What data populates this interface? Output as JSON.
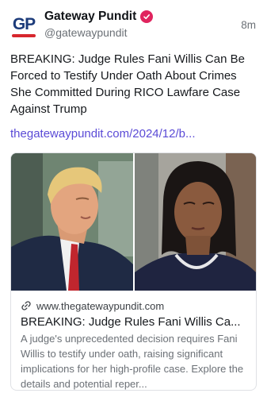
{
  "author": {
    "display_name": "Gateway Pundit",
    "handle": "@gatewaypundit",
    "avatar_text": "GP",
    "verified": true
  },
  "timestamp": "8m",
  "post": {
    "text": "BREAKING: Judge Rules Fani Willis Can Be Forced to Testify Under Oath About Crimes She Committed During RICO Lawfare Case Against Trump",
    "link_text": "thegatewaypundit.com/2024/12/b..."
  },
  "card": {
    "domain": "www.thegatewaypundit.com",
    "title": "BREAKING: Judge Rules Fani Willis Ca...",
    "description": "A judge's unprecedented decision requires Fani Willis to testify under oath, raising significant implications for her high-profile case. Explore the details and potential reper..."
  },
  "colors": {
    "link": "#5b4bd6",
    "verified_badge": "#e0245e",
    "text": "#16191d",
    "muted": "#6b7076"
  }
}
